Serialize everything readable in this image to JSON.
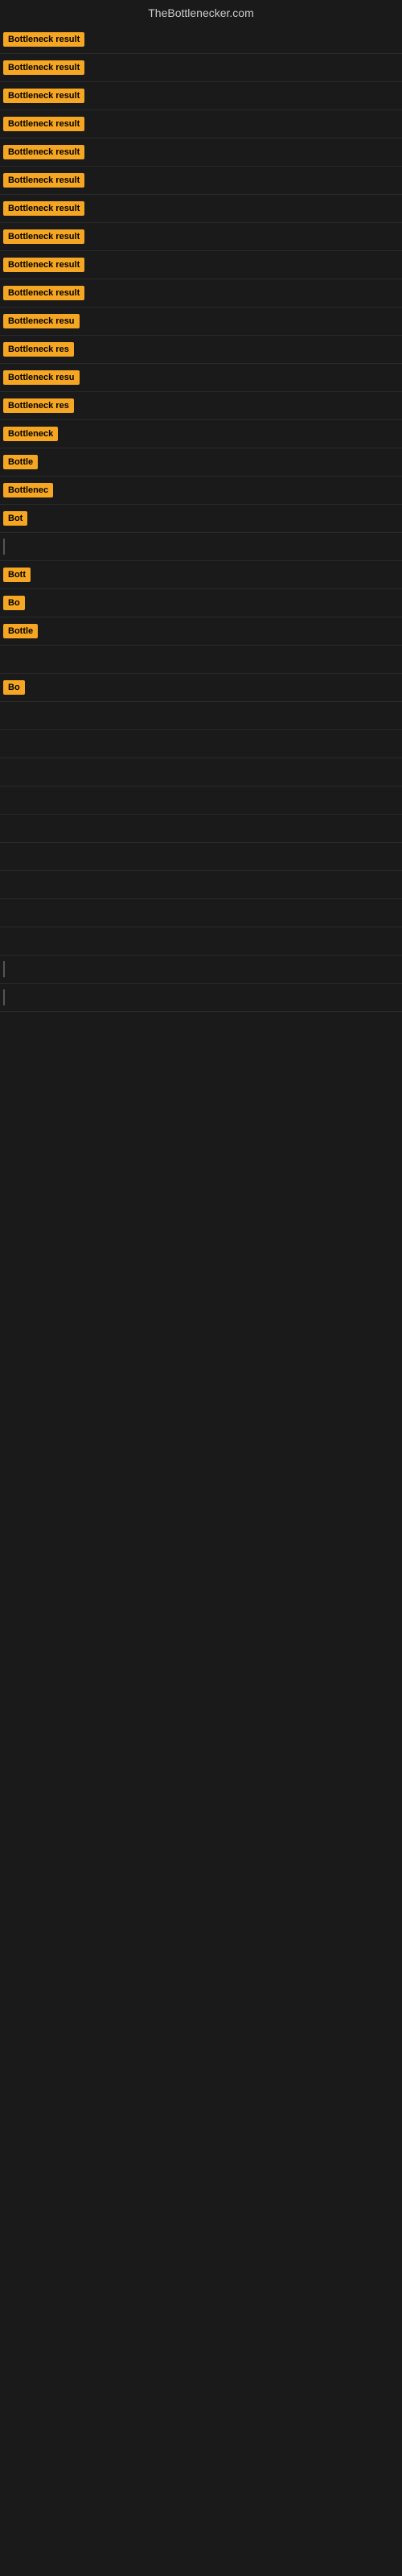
{
  "site": {
    "title": "TheBottlenecker.com"
  },
  "rows": [
    {
      "id": 1,
      "badge_text": "Bottleneck result",
      "truncated": false,
      "has_line": false
    },
    {
      "id": 2,
      "badge_text": "Bottleneck result",
      "truncated": false,
      "has_line": false
    },
    {
      "id": 3,
      "badge_text": "Bottleneck result",
      "truncated": false,
      "has_line": false
    },
    {
      "id": 4,
      "badge_text": "Bottleneck result",
      "truncated": false,
      "has_line": false
    },
    {
      "id": 5,
      "badge_text": "Bottleneck result",
      "truncated": false,
      "has_line": false
    },
    {
      "id": 6,
      "badge_text": "Bottleneck result",
      "truncated": false,
      "has_line": false
    },
    {
      "id": 7,
      "badge_text": "Bottleneck result",
      "truncated": false,
      "has_line": false
    },
    {
      "id": 8,
      "badge_text": "Bottleneck result",
      "truncated": false,
      "has_line": false
    },
    {
      "id": 9,
      "badge_text": "Bottleneck result",
      "truncated": false,
      "has_line": false
    },
    {
      "id": 10,
      "badge_text": "Bottleneck result",
      "truncated": false,
      "has_line": false
    },
    {
      "id": 11,
      "badge_text": "Bottleneck resu",
      "truncated": true,
      "has_line": false
    },
    {
      "id": 12,
      "badge_text": "Bottleneck res",
      "truncated": true,
      "has_line": false
    },
    {
      "id": 13,
      "badge_text": "Bottleneck resu",
      "truncated": true,
      "has_line": false
    },
    {
      "id": 14,
      "badge_text": "Bottleneck res",
      "truncated": true,
      "has_line": false
    },
    {
      "id": 15,
      "badge_text": "Bottleneck",
      "truncated": true,
      "has_line": false
    },
    {
      "id": 16,
      "badge_text": "Bottle",
      "truncated": true,
      "has_line": false
    },
    {
      "id": 17,
      "badge_text": "Bottlenec",
      "truncated": true,
      "has_line": false
    },
    {
      "id": 18,
      "badge_text": "Bot",
      "truncated": true,
      "has_line": false
    },
    {
      "id": 19,
      "badge_text": "",
      "truncated": true,
      "has_line": true
    },
    {
      "id": 20,
      "badge_text": "Bott",
      "truncated": true,
      "has_line": false
    },
    {
      "id": 21,
      "badge_text": "Bo",
      "truncated": true,
      "has_line": false
    },
    {
      "id": 22,
      "badge_text": "Bottle",
      "truncated": true,
      "has_line": false
    },
    {
      "id": 23,
      "badge_text": "",
      "truncated": true,
      "has_line": false
    },
    {
      "id": 24,
      "badge_text": "Bo",
      "truncated": true,
      "has_line": false
    },
    {
      "id": 25,
      "badge_text": "",
      "truncated": true,
      "has_line": false
    },
    {
      "id": 26,
      "badge_text": "",
      "truncated": true,
      "has_line": false
    },
    {
      "id": 27,
      "badge_text": "",
      "truncated": true,
      "has_line": false
    },
    {
      "id": 28,
      "badge_text": "",
      "truncated": true,
      "has_line": false
    },
    {
      "id": 29,
      "badge_text": "",
      "truncated": true,
      "has_line": false
    },
    {
      "id": 30,
      "badge_text": "",
      "truncated": true,
      "has_line": false
    },
    {
      "id": 31,
      "badge_text": "",
      "truncated": true,
      "has_line": false
    },
    {
      "id": 32,
      "badge_text": "",
      "truncated": true,
      "has_line": false
    },
    {
      "id": 33,
      "badge_text": "",
      "truncated": true,
      "has_line": false
    },
    {
      "id": 34,
      "badge_text": "",
      "truncated": true,
      "has_line": true
    },
    {
      "id": 35,
      "badge_text": "",
      "truncated": true,
      "has_line": true
    }
  ]
}
